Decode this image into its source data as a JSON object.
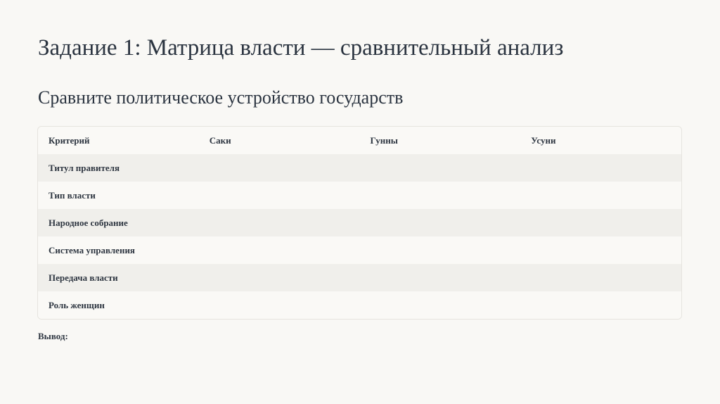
{
  "slide": {
    "title": "Задание 1: Матрица власти — сравнительный анализ",
    "subtitle": "Сравните политическое устройство государств"
  },
  "table": {
    "headers": [
      "Критерий",
      "Саки",
      "Гунны",
      "Усуни"
    ],
    "rows": [
      [
        "Титул правителя",
        "",
        "",
        ""
      ],
      [
        "Тип власти",
        "",
        "",
        ""
      ],
      [
        "Народное собрание",
        "",
        "",
        ""
      ],
      [
        "Система управления",
        "",
        "",
        ""
      ],
      [
        "Передача власти",
        "",
        "",
        ""
      ],
      [
        "Роль женщин",
        "",
        "",
        ""
      ]
    ]
  },
  "conclusion": {
    "label": "Вывод:"
  }
}
